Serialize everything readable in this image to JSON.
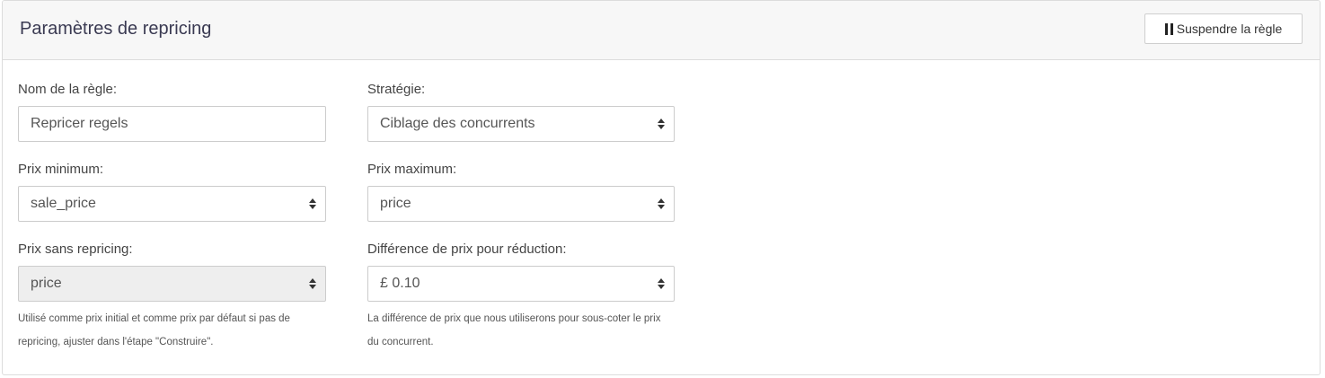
{
  "header": {
    "title": "Paramètres de repricing",
    "suspend_label": "Suspendre la règle"
  },
  "fields": {
    "rule_name": {
      "label": "Nom de la règle:",
      "value": "Repricer regels"
    },
    "strategy": {
      "label": "Stratégie:",
      "value": "Ciblage des concurrents"
    },
    "min_price": {
      "label": "Prix minimum:",
      "value": "sale_price"
    },
    "max_price": {
      "label": "Prix maximum:",
      "value": "price"
    },
    "no_repricing_price": {
      "label": "Prix sans repricing:",
      "value": "price",
      "help": "Utilisé comme prix initial et comme prix par défaut si pas de repricing, ajuster dans l'étape \"Construire\"."
    },
    "price_difference": {
      "label": "Différence de prix pour réduction:",
      "value": "£ 0.10",
      "help": "La différence de prix que nous utiliserons pour sous-coter le prix du concurrent."
    }
  },
  "icons": {
    "suspend": "pause-icon",
    "select_caret": "sort-caret-icon"
  }
}
